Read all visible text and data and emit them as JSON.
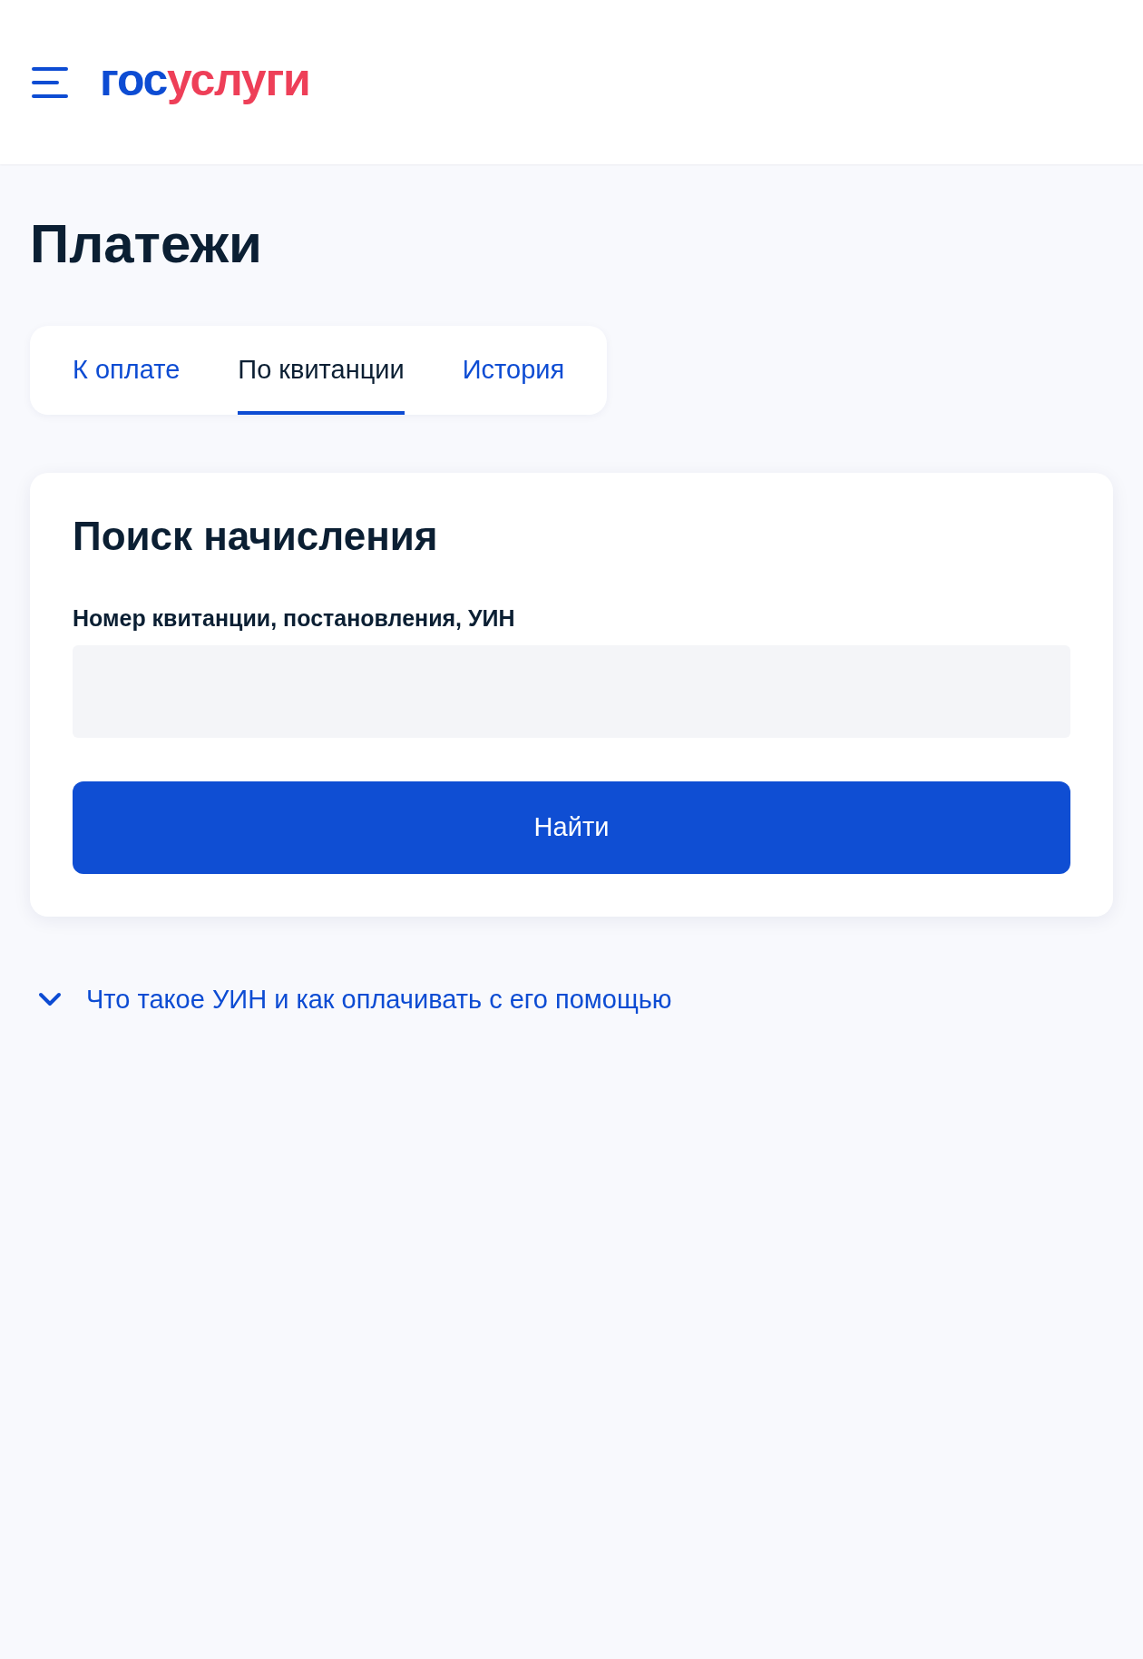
{
  "header": {
    "logo": {
      "first": "гос",
      "second": "услуги"
    }
  },
  "title": "Платежи",
  "tabs": [
    {
      "label": "К оплате",
      "selected": false
    },
    {
      "label": "По квитанции",
      "selected": true
    },
    {
      "label": "История",
      "selected": false
    }
  ],
  "search_card": {
    "heading": "Поиск начисления",
    "field_label": "Номер квитанции, постановления, УИН",
    "button": "Найти"
  },
  "faq": {
    "label": "Что такое УИН и как оплачивать с его помощью",
    "expanded": false
  }
}
